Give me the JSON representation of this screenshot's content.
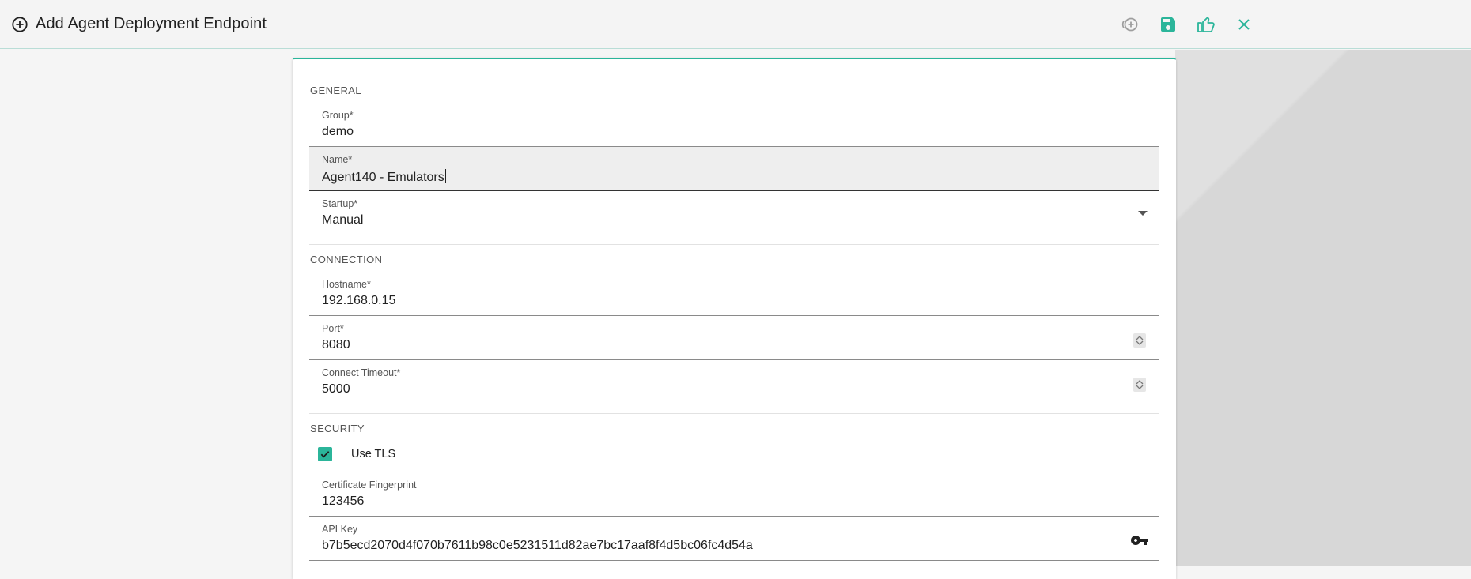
{
  "header": {
    "title": "Add Agent Deployment Endpoint",
    "title_icon": "add-circle-outline-icon",
    "toolbar": [
      {
        "name": "add-another-button",
        "icon": "add-circle-plus-icon",
        "color": "#9e9e9e"
      },
      {
        "name": "save-button",
        "icon": "save-icon",
        "color": "#2bb59a"
      },
      {
        "name": "approve-button",
        "icon": "thumb-up-icon",
        "color": "#2bb59a"
      },
      {
        "name": "close-button",
        "icon": "close-icon",
        "color": "#2bb59a"
      }
    ]
  },
  "colors": {
    "accent": "#2bb59a",
    "text": "#212121",
    "muted": "#555555"
  },
  "form": {
    "general": {
      "title": "GENERAL",
      "group": {
        "label": "Group*",
        "value": "demo"
      },
      "name": {
        "label": "Name*",
        "value": "Agent140 - Emulators"
      },
      "startup": {
        "label": "Startup*",
        "value": "Manual"
      }
    },
    "connection": {
      "title": "CONNECTION",
      "hostname": {
        "label": "Hostname*",
        "value": "192.168.0.15"
      },
      "port": {
        "label": "Port*",
        "value": "8080"
      },
      "connect_timeout": {
        "label": "Connect Timeout*",
        "value": "5000"
      }
    },
    "security": {
      "title": "SECURITY",
      "use_tls": {
        "label": "Use TLS",
        "checked": true
      },
      "certificate_fingerprint": {
        "label": "Certificate Fingerprint",
        "value": "123456"
      },
      "api_key": {
        "label": "API Key",
        "value": "b7b5ecd2070d4f070b7611b98c0e5231511d82ae7bc17aaf8f4d5bc06fc4d54a"
      }
    }
  }
}
